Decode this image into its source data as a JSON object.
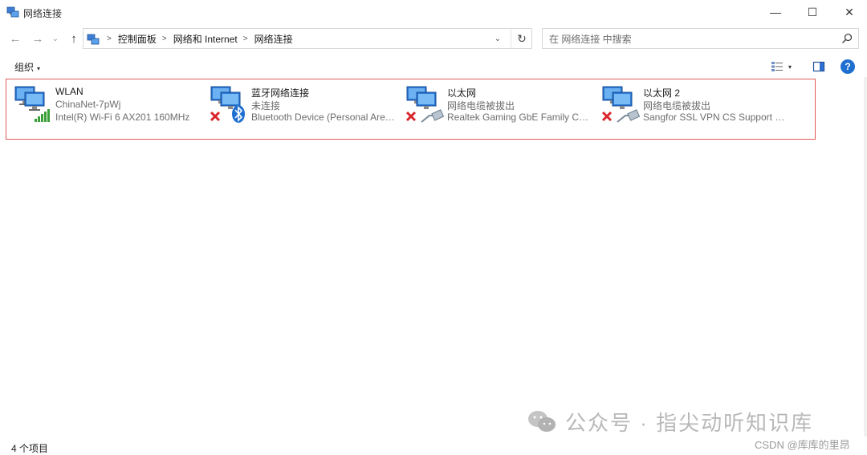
{
  "window": {
    "title": "网络连接",
    "buttons": {
      "minimize": "—",
      "maximize": "☐",
      "close": "✕"
    }
  },
  "nav": {
    "back_icon": "←",
    "forward_icon": "→",
    "recent_icon": "⌄",
    "up_icon": "↑",
    "breadcrumbs": [
      "控制面板",
      "网络和 Internet",
      "网络连接"
    ],
    "dropdown_icon": "⌄",
    "refresh_icon": "↻",
    "search_placeholder": "在 网络连接 中搜索"
  },
  "toolbar": {
    "organize_label": "组织",
    "caret": "▾",
    "view_caret": "▾",
    "help_label": "?"
  },
  "connections": [
    {
      "name": "WLAN",
      "status": "ChinaNet-7pWj",
      "device": "Intel(R) Wi-Fi 6 AX201 160MHz",
      "icon": "wifi-network-icon",
      "badge": "signal-bars-icon"
    },
    {
      "name": "蓝牙网络连接",
      "status": "未连接",
      "device": "Bluetooth Device (Personal Area Network)",
      "icon": "network-computer-icon",
      "badge": "bluetooth-icon"
    },
    {
      "name": "以太网",
      "status": "网络电缆被拔出",
      "device": "Realtek Gaming GbE Family Controller",
      "icon": "network-computer-icon",
      "badge": "ethernet-cable-icon"
    },
    {
      "name": "以太网 2",
      "status": "网络电缆被拔出",
      "device": "Sangfor SSL VPN CS Support System",
      "icon": "network-computer-icon",
      "badge": "ethernet-cable-icon"
    }
  ],
  "statusbar": {
    "item_count": "4 个项目"
  },
  "watermark": {
    "text": "公众号 · 指尖动听知识库",
    "credit": "CSDN @库库的里昂"
  },
  "colors": {
    "selection_border": "#e15a5a",
    "help_blue": "#1e6fd0",
    "signal_green": "#3aa03a",
    "error_red": "#d9262c",
    "bluetooth_blue": "#1f6fd1"
  }
}
